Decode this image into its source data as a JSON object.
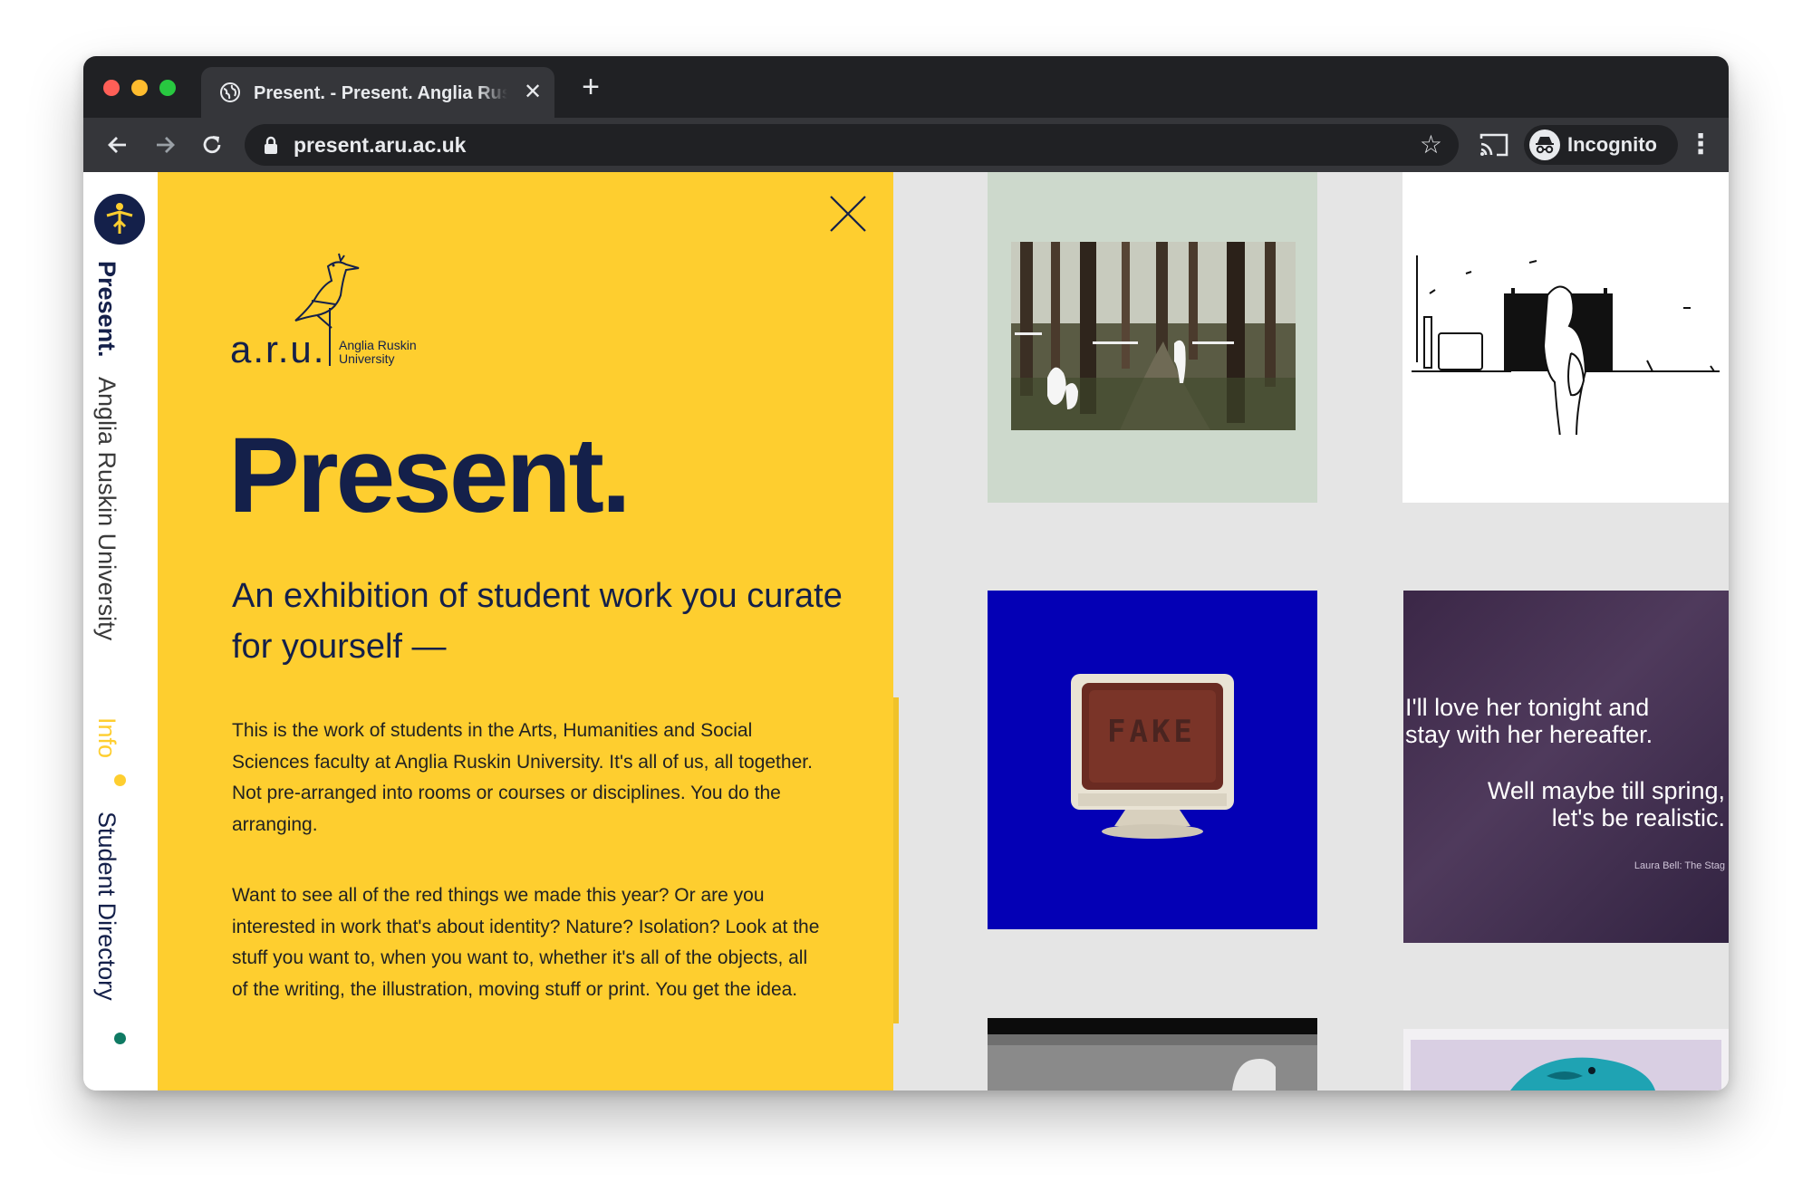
{
  "browser": {
    "tab_title": "Present. - Present. Anglia Ruskin University",
    "url": "present.aru.ac.uk",
    "profile_label": "Incognito",
    "traffic_light_colors": [
      "#fe5f57",
      "#febc2e",
      "#28c840"
    ]
  },
  "sidebar": {
    "brand": "Present.",
    "university": "Anglia Ruskin University",
    "info_link": "Info",
    "directory_link": "Student Directory",
    "info_color": "#fece2f",
    "directory_color": "#0f7a63"
  },
  "panel": {
    "logo_word": "a.r.u.",
    "logo_line1": "Anglia Ruskin",
    "logo_line2": "University",
    "title": "Present.",
    "subtitle": "An exhibition of student work you curate for yourself —",
    "paragraph1": "This is the work of students in the Arts, Humanities and Social Sciences faculty at Anglia Ruskin University. It's all of us, all together. Not pre-arranged into rooms or courses or disciplines. You do the arranging.",
    "paragraph2": "Want to see all of the red things we made this year? Or are you interested in work that's about identity? Nature? Isolation? Look at the stuff you want to, when you want to, whether it's all of the objects, all of the writing, the illustration, moving stuff or print. You get the idea.",
    "accent_color": "#fece2f",
    "ink_color": "#14204a"
  },
  "gallery": {
    "fake_label": "FAKE",
    "quote_line1": "I'll love her tonight and",
    "quote_line2": "stay with her hereafter.",
    "quote_line3": "Well maybe till spring,",
    "quote_line4": "let's be realistic.",
    "quote_credit": "Laura Bell: The Stag"
  }
}
